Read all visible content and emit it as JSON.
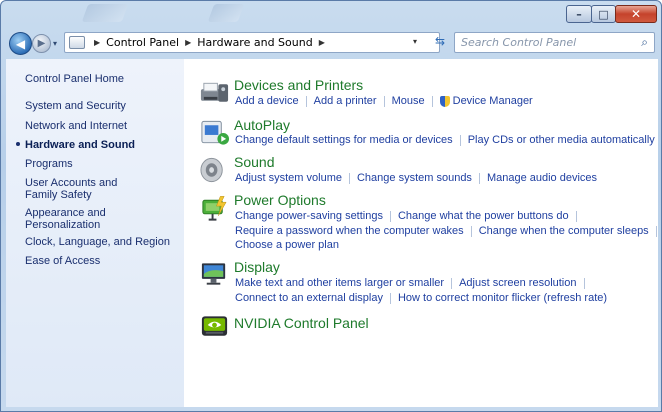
{
  "window": {
    "controls": {
      "minimize": "–",
      "maximize": "□",
      "close": "✕"
    }
  },
  "navbar": {
    "back_icon": "◀",
    "forward_icon": "▶",
    "recent_icon": "▾",
    "breadcrumb": [
      "Control Panel",
      "Hardware and Sound"
    ],
    "crumb_separator": "▶",
    "dropdown_icon": "▾",
    "refresh_icon": "⇆",
    "search_placeholder": "Search Control Panel",
    "search_icon": "⌕"
  },
  "sidebar": {
    "items": [
      {
        "label": "Control Panel Home"
      },
      {
        "label": "System and Security"
      },
      {
        "label": "Network and Internet"
      },
      {
        "label": "Hardware and Sound",
        "active": true
      },
      {
        "label": "Programs"
      },
      {
        "label": "User Accounts and Family Safety"
      },
      {
        "label": "Appearance and Personalization"
      },
      {
        "label": "Clock, Language, and Region"
      },
      {
        "label": "Ease of Access"
      }
    ]
  },
  "categories": [
    {
      "title": "Devices and Printers",
      "icon": "printer-icon",
      "rows": [
        [
          "Add a device",
          "Add a printer",
          "Mouse",
          "Device Manager"
        ]
      ]
    },
    {
      "title": "AutoPlay",
      "icon": "autoplay-icon",
      "rows": [
        [
          "Change default settings for media or devices",
          "Play CDs or other media automatically"
        ]
      ]
    },
    {
      "title": "Sound",
      "icon": "speaker-icon",
      "rows": [
        [
          "Adjust system volume",
          "Change system sounds",
          "Manage audio devices"
        ]
      ]
    },
    {
      "title": "Power Options",
      "icon": "power-icon",
      "rows": [
        [
          "Change power-saving settings",
          "Change what the power buttons do"
        ],
        [
          "Require a password when the computer wakes",
          "Change when the computer sleeps"
        ],
        [
          "Choose a power plan"
        ]
      ]
    },
    {
      "title": "Display",
      "icon": "monitor-icon",
      "rows": [
        [
          "Make text and other items larger or smaller",
          "Adjust screen resolution"
        ],
        [
          "Connect to an external display",
          "How to correct monitor flicker (refresh rate)"
        ]
      ]
    },
    {
      "title": "NVIDIA Control Panel",
      "icon": "nvidia-icon",
      "rows": []
    }
  ],
  "colors": {
    "category_title": "#1e7a2b",
    "task_link": "#1f3fa0",
    "sidebar_link": "#1a2f6e"
  }
}
